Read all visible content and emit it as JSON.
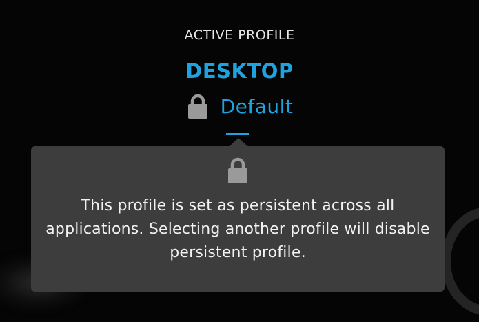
{
  "header": {
    "label": "ACTIVE PROFILE"
  },
  "profile": {
    "name": "DESKTOP",
    "selected": "Default",
    "lock_icon": "lock-icon"
  },
  "tooltip": {
    "icon": "lock-icon",
    "message": "This profile is set as persistent across all applications. Selecting another profile will disable persistent profile."
  },
  "colors": {
    "accent": "#1fa3e0",
    "background": "#050505",
    "tooltip_bg": "#3d3d3d",
    "lock_gray": "#9a9a9a"
  }
}
